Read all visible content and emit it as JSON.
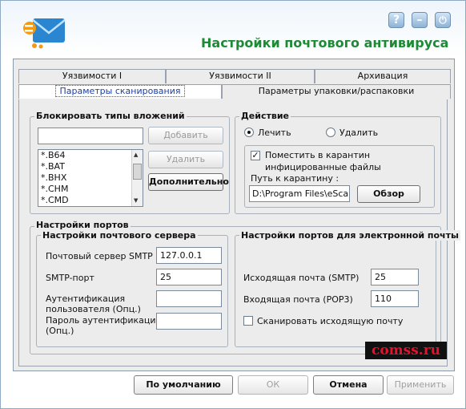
{
  "app": {
    "title": "Настройки почтового антивируса",
    "help_glyph": "?",
    "minimize_glyph": "–",
    "power_glyph": "⏻",
    "accent": "#1d8a36"
  },
  "tabs": {
    "row1": [
      "Уязвимости I",
      "Уязвимости II",
      "Архивация"
    ],
    "row2": [
      "Параметры сканирования",
      "Параметры упаковки/распаковки"
    ]
  },
  "block_attachments": {
    "title": "Блокировать типы вложений",
    "input_value": "",
    "add_label": "Добавить",
    "remove_label": "Удалить",
    "more_label": "Дополнительно",
    "items": [
      "*.B64",
      "*.BAT",
      "*.BHX",
      "*.CHM",
      "*.CMD"
    ]
  },
  "action": {
    "title": "Действие",
    "cure_label": "Лечить",
    "delete_label": "Удалить",
    "quarantine_line1": "Поместить в карантин",
    "quarantine_line2": "инфицированные файлы",
    "quarantine_checked": true,
    "path_label": "Путь к карантину :",
    "path_value": "D:\\Program Files\\eScan\\Q",
    "browse_label": "Обзор"
  },
  "ports": {
    "title": "Настройки портов",
    "server": {
      "title": "Настройки почтового сервера",
      "smtp_server_label": "Почтовый сервер SMTP",
      "smtp_server_value": "127.0.0.1",
      "smtp_port_label": "SMTP-порт",
      "smtp_port_value": "25",
      "auth_user_label1": "Аутентификация",
      "auth_user_label2": "пользователя (Опц.)",
      "auth_user_value": "",
      "auth_pass_label1": "Пароль аутентификации",
      "auth_pass_label2": "(Опц.)",
      "auth_pass_value": ""
    },
    "email": {
      "title": "Настройки портов для электронной почты",
      "outgoing_label": "Исходящая почта (SMTP)",
      "outgoing_value": "25",
      "incoming_label": "Входящая почта (POP3)",
      "incoming_value": "110",
      "scan_outgoing_label": "Сканировать исходящую почту",
      "scan_outgoing_checked": false
    }
  },
  "footer": {
    "default_label": "По умолчанию",
    "ok_label": "ОК",
    "cancel_label": "Отмена",
    "apply_label": "Применить"
  },
  "watermark": "comss.ru"
}
